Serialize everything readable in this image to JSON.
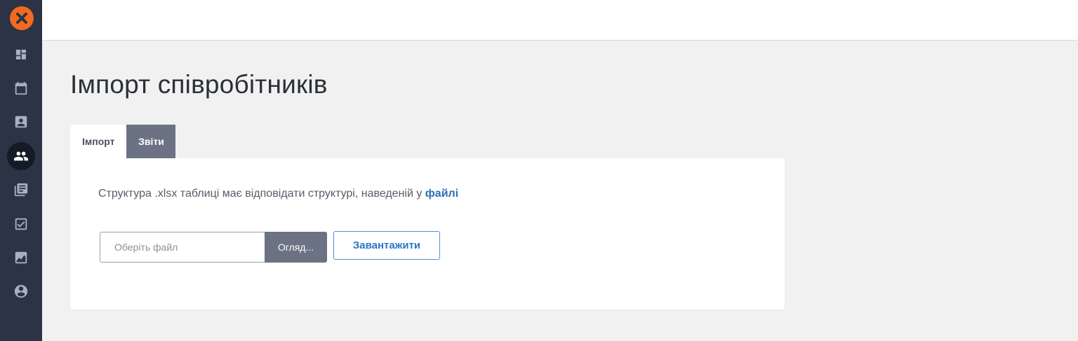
{
  "sidebar": {
    "logo_icon": "close-x-icon",
    "items": [
      {
        "icon": "dashboard-icon",
        "active": false
      },
      {
        "icon": "calendar-icon",
        "active": false
      },
      {
        "icon": "contact-folder-icon",
        "active": false
      },
      {
        "icon": "people-icon",
        "active": true
      },
      {
        "icon": "library-books-icon",
        "active": false
      },
      {
        "icon": "checkbox-icon",
        "active": false
      },
      {
        "icon": "chart-icon",
        "active": false
      },
      {
        "icon": "account-circle-icon",
        "active": false
      }
    ]
  },
  "page": {
    "title": "Імпорт співробітників"
  },
  "tabs": [
    {
      "label": "Імпорт",
      "active": true
    },
    {
      "label": "Звіти",
      "active": false
    }
  ],
  "import_card": {
    "hint_text": "Структура .xlsx таблиці має відповідати структурі, наведеній у ",
    "hint_link": "файлі",
    "file_placeholder": "Оберіть файл",
    "browse_label": "Огляд...",
    "upload_label": "Завантажити"
  },
  "colors": {
    "sidebar_bg": "#2b3344",
    "accent": "#f26a21",
    "link": "#2c6eb5",
    "tab_inactive": "#6b7284"
  }
}
